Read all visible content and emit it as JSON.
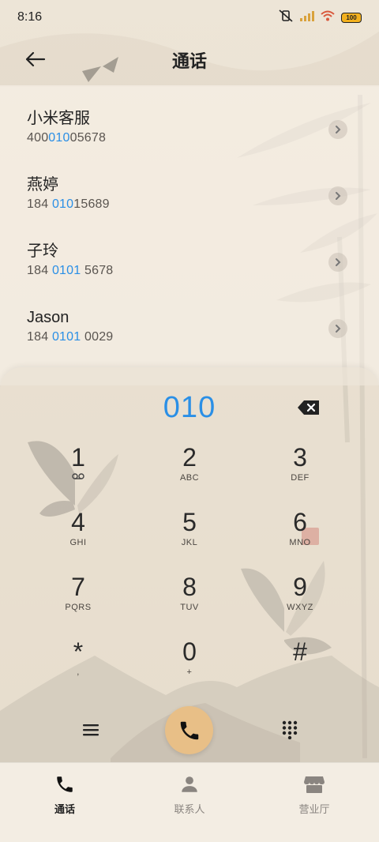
{
  "status_bar": {
    "time": "8:16",
    "battery": "100"
  },
  "header": {
    "title": "通话"
  },
  "contacts": [
    {
      "name": "小米客服",
      "number_pre": "400",
      "number_match": "010",
      "number_post": "05678"
    },
    {
      "name": "燕婷",
      "number_pre": "184 ",
      "number_match": "010",
      "number_post": "15689"
    },
    {
      "name": "子玲",
      "number_pre": "184 ",
      "number_match": "0101",
      "number_post": " 5678"
    },
    {
      "name": "Jason",
      "number_pre": "184 ",
      "number_match": "0101",
      "number_post": " 0029"
    }
  ],
  "dialer": {
    "input": "010",
    "keys": [
      {
        "digit": "1",
        "letters": ""
      },
      {
        "digit": "2",
        "letters": "ABC"
      },
      {
        "digit": "3",
        "letters": "DEF"
      },
      {
        "digit": "4",
        "letters": "GHI"
      },
      {
        "digit": "5",
        "letters": "JKL"
      },
      {
        "digit": "6",
        "letters": "MNO"
      },
      {
        "digit": "7",
        "letters": "PQRS"
      },
      {
        "digit": "8",
        "letters": "TUV"
      },
      {
        "digit": "9",
        "letters": "WXYZ"
      },
      {
        "digit": "*",
        "letters": ","
      },
      {
        "digit": "0",
        "letters": "+"
      },
      {
        "digit": "#",
        "letters": ""
      }
    ]
  },
  "bottom_nav": [
    {
      "label": "通话",
      "icon": "phone-icon",
      "active": true
    },
    {
      "label": "联系人",
      "icon": "person-icon",
      "active": false
    },
    {
      "label": "营业厅",
      "icon": "store-icon",
      "active": false
    }
  ],
  "colors": {
    "accent": "#2a8fe6",
    "call_button": "#e8bf87",
    "background": "#ece4d6"
  }
}
